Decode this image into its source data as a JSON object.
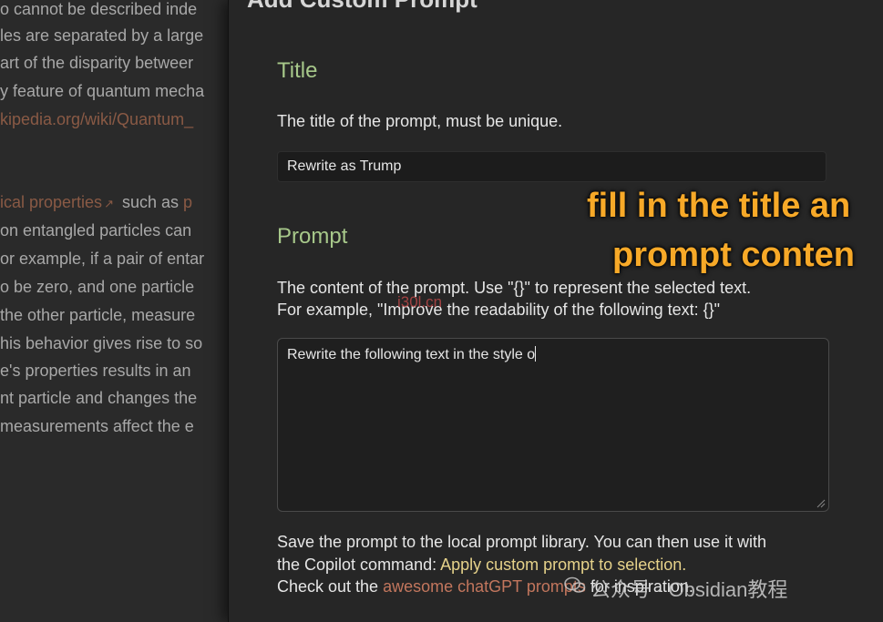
{
  "background_editor": {
    "lines": [
      "o cannot be described inde",
      "les are separated by a large",
      "art of the disparity betweer",
      "y feature of quantum mecha",
      "kipedia.org/wiki/Quantum_",
      "ical properties",
      " such as ",
      "p",
      " on entangled particles can",
      "or example, if a pair of entar",
      "o be zero, and one particle",
      " the other particle, measure",
      "his behavior gives rise to so",
      "e's properties results in an",
      "nt particle and changes the",
      " measurements affect the e"
    ]
  },
  "modal": {
    "title": "Add Custom Prompt",
    "title_section": {
      "heading": "Title",
      "description": "The title of the prompt, must be unique.",
      "value": "Rewrite as Trump"
    },
    "prompt_section": {
      "heading": "Prompt",
      "description_line1": "The content of the prompt. Use \"{}\" to represent the selected text.",
      "description_line2": "For example, \"Improve the readability of the following text: {}\"",
      "value": "Rewrite the following text in the style o"
    },
    "footer": {
      "line1": "Save the prompt to the local prompt library. You can then use it with",
      "line2_prefix": "the Copilot command: ",
      "line2_command": "Apply custom prompt to selection.",
      "line3_prefix": "Check out the ",
      "line3_link": "awesome chatGPT prompts",
      "line3_suffix": " for inspiration."
    }
  },
  "annotation": {
    "line1": "fill in the title an",
    "line2": "prompt conten"
  },
  "watermarks": {
    "site": "i30l.cn",
    "account": "公众号 · Obsidian教程"
  },
  "colors": {
    "heading_green": "#a7c88a",
    "command_yellow": "#e6d28a",
    "link_orange": "#c2765d",
    "annotation_orange": "#f7a928"
  }
}
